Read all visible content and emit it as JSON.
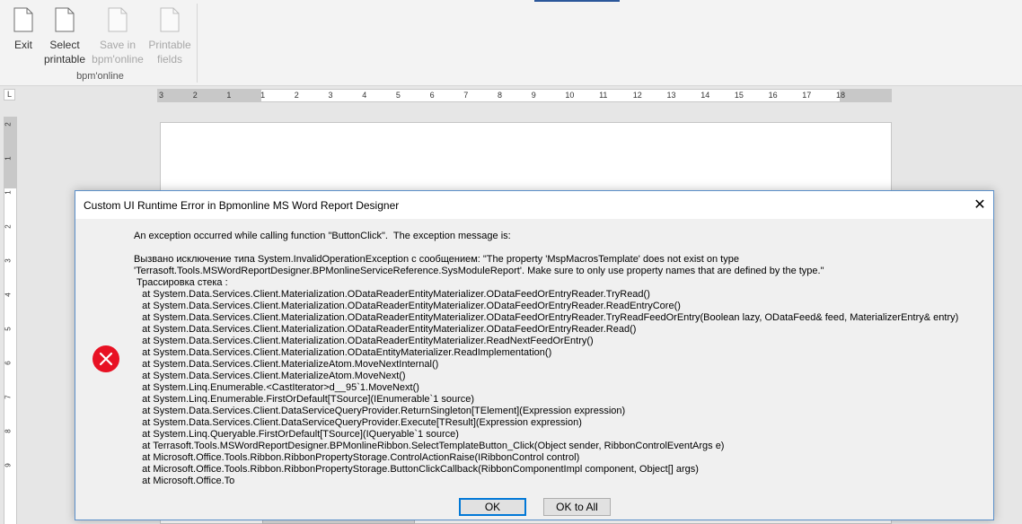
{
  "ribbon": {
    "buttons": [
      {
        "label": "Exit",
        "icon": "document-icon",
        "enabled": true
      },
      {
        "label": "Select\nprintable",
        "icon": "document-icon",
        "enabled": true
      },
      {
        "label": "Save in\nbpm'online",
        "icon": "document-icon",
        "enabled": false
      },
      {
        "label": "Printable\nfields",
        "icon": "document-icon",
        "enabled": false
      }
    ],
    "group_label": "bpm'online"
  },
  "ruler": {
    "corner_glyph": "L",
    "h_ticks": [
      "3",
      "2",
      "1",
      "1",
      "2",
      "3",
      "4",
      "5",
      "6",
      "7",
      "8",
      "9",
      "10",
      "11",
      "12",
      "13",
      "14",
      "15",
      "16",
      "17",
      "18"
    ],
    "v_ticks": [
      "2",
      "1",
      "1",
      "2",
      "3",
      "4",
      "5",
      "6",
      "7",
      "8",
      "9"
    ]
  },
  "dialog": {
    "title": "Custom UI Runtime Error in Bpmonline MS Word Report Designer",
    "close_glyph": "✕",
    "icon": "error-icon",
    "lines": [
      "An exception occurred while calling function \"ButtonClick\".  The exception message is:",
      "",
      "Вызвано исключение типа System.InvalidOperationException с сообщением: \"The property 'MspMacrosTemplate' does not exist on type",
      "'Terrasoft.Tools.MSWordReportDesigner.BPMonlineServiceReference.SysModuleReport'. Make sure to only use property names that are defined by the type.\"",
      " Трассировка стека :",
      "   at System.Data.Services.Client.Materialization.ODataReaderEntityMaterializer.ODataFeedOrEntryReader.TryRead()",
      "   at System.Data.Services.Client.Materialization.ODataReaderEntityMaterializer.ODataFeedOrEntryReader.ReadEntryCore()",
      "   at System.Data.Services.Client.Materialization.ODataReaderEntityMaterializer.ODataFeedOrEntryReader.TryReadFeedOrEntry(Boolean lazy, ODataFeed& feed, MaterializerEntry& entry)",
      "   at System.Data.Services.Client.Materialization.ODataReaderEntityMaterializer.ODataFeedOrEntryReader.Read()",
      "   at System.Data.Services.Client.Materialization.ODataReaderEntityMaterializer.ReadNextFeedOrEntry()",
      "   at System.Data.Services.Client.Materialization.ODataEntityMaterializer.ReadImplementation()",
      "   at System.Data.Services.Client.MaterializeAtom.MoveNextInternal()",
      "   at System.Data.Services.Client.MaterializeAtom.MoveNext()",
      "   at System.Linq.Enumerable.<CastIterator>d__95`1.MoveNext()",
      "   at System.Linq.Enumerable.FirstOrDefault[TSource](IEnumerable`1 source)",
      "   at System.Data.Services.Client.DataServiceQueryProvider.ReturnSingleton[TElement](Expression expression)",
      "   at System.Data.Services.Client.DataServiceQueryProvider.Execute[TResult](Expression expression)",
      "   at System.Linq.Queryable.FirstOrDefault[TSource](IQueryable`1 source)",
      "   at Terrasoft.Tools.MSWordReportDesigner.BPMonlineRibbon.SelectTemplateButton_Click(Object sender, RibbonControlEventArgs e)",
      "   at Microsoft.Office.Tools.Ribbon.RibbonPropertyStorage.ControlActionRaise(IRibbonControl control)",
      "   at Microsoft.Office.Tools.Ribbon.RibbonPropertyStorage.ButtonClickCallback(RibbonComponentImpl component, Object[] args)",
      "   at Microsoft.Office.To"
    ],
    "buttons": {
      "ok": "OK",
      "ok_to_all": "OK to All"
    }
  },
  "colors": {
    "ribbon_bg": "#f3f3f3",
    "accent": "#2b579a",
    "dialog_border": "#5b8fc9",
    "error_red": "#e81123",
    "default_button_border": "#0078d7"
  }
}
